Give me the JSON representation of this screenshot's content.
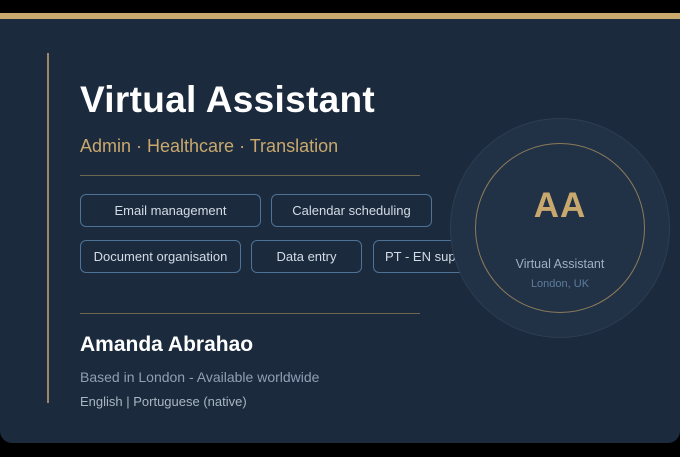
{
  "card": {
    "title": "Virtual Assistant",
    "subtitle": "Admin · Healthcare · Translation",
    "tags": [
      "Email management",
      "Calendar scheduling",
      "Document organisation",
      "Data entry",
      "PT - EN sup"
    ],
    "name": "Amanda Abrahao",
    "location": "Based in London - Available worldwide",
    "languages": "English | Portuguese (native)"
  },
  "badge": {
    "initials": "AA",
    "role": "Virtual Assistant",
    "location": "London, UK"
  },
  "colors": {
    "background": "#1b2a3c",
    "accent_gold": "#c9a86e",
    "tag_border": "#4e7396",
    "text_white": "#ffffff"
  }
}
